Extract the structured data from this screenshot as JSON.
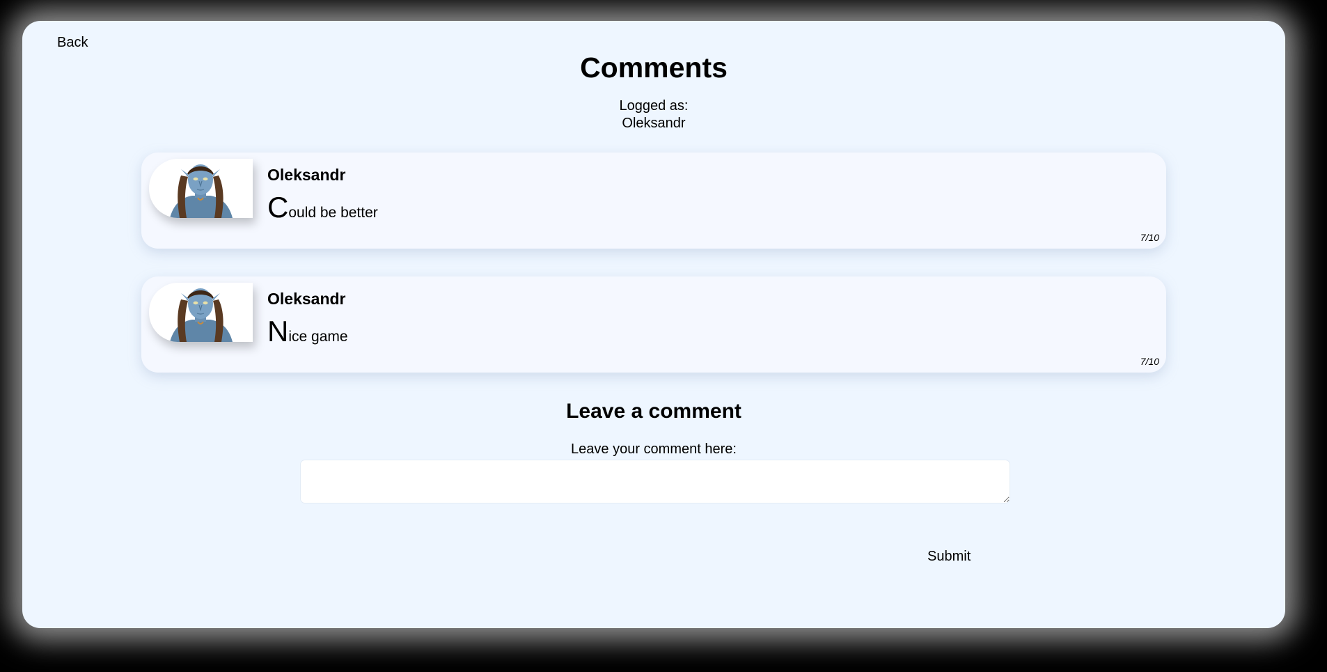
{
  "nav": {
    "back_label": "Back"
  },
  "header": {
    "title": "Comments",
    "logged_as_label": "Logged as:",
    "logged_user": "Oleksandr"
  },
  "comments": [
    {
      "author": "Oleksandr",
      "text": "Could be better",
      "rating": "7/10",
      "avatar_icon": "avatar-navi-character"
    },
    {
      "author": "Oleksandr",
      "text": "Nice game",
      "rating": "7/10",
      "avatar_icon": "avatar-navi-character"
    }
  ],
  "form": {
    "title": "Leave a comment",
    "label": "Leave your comment here:",
    "value": "",
    "submit_label": "Submit"
  },
  "colors": {
    "page_background": "#000000",
    "panel_background": "#eef6ff",
    "card_background": "#f5f8ff",
    "text": "#000000"
  }
}
